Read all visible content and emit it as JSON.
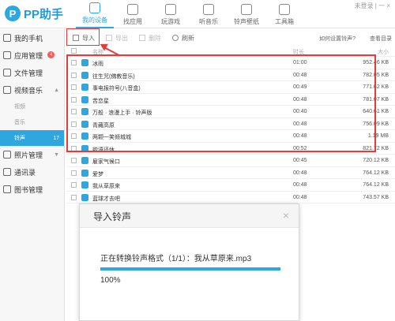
{
  "app": {
    "logo_text": "PP助手",
    "logo_mark": "P",
    "top_right": "未登录 | 一 ×"
  },
  "nav": [
    {
      "label": "我的设备",
      "icon": "phone-icon",
      "active": true
    },
    {
      "label": "找应用",
      "icon": "apps-icon",
      "active": false
    },
    {
      "label": "玩游戏",
      "icon": "game-icon",
      "active": false
    },
    {
      "label": "听音乐",
      "icon": "music-icon",
      "active": false
    },
    {
      "label": "铃声壁纸",
      "icon": "wallpaper-icon",
      "active": false
    },
    {
      "label": "工具箱",
      "icon": "toolbox-icon",
      "active": false
    }
  ],
  "sidebar": {
    "my_phone": "我的手机",
    "apps": "应用管理",
    "apps_badge": "4",
    "files": "文件管理",
    "video_music": "视频音乐",
    "sub_video": "视频",
    "sub_music": "音乐",
    "sub_ringtone": "铃声",
    "ringtone_count": "17",
    "photos": "照片管理",
    "contacts": "通讯录",
    "books": "图书管理"
  },
  "toolbar": {
    "import": "导入",
    "export": "导出",
    "delete": "删除",
    "refresh": "刷新",
    "help": "如何设置铃声?",
    "dir": "查看目录"
  },
  "table": {
    "headers": {
      "name": "名称",
      "duration": "时长",
      "size": "大小"
    },
    "rows": [
      {
        "name": "冰雨",
        "duration": "01:00",
        "size": "952.46 KB"
      },
      {
        "name": "往生咒(佛教音乐)",
        "duration": "00:48",
        "size": "782.05 KB"
      },
      {
        "name": "事电报符号(八音盒)",
        "duration": "00:49",
        "size": "771.62 KB"
      },
      {
        "name": "苦恋星",
        "duration": "00:48",
        "size": "781.07 KB"
      },
      {
        "name": "万般 · 浪漫上手 · 铃声版",
        "duration": "00:40",
        "size": "640.61 KB"
      },
      {
        "name": "青藏高原",
        "duration": "00:48",
        "size": "756.09 KB"
      },
      {
        "name": "两颗一笑倾城城",
        "duration": "00:48",
        "size": "1.19 MB"
      },
      {
        "name": "欲语还休",
        "duration": "00:52",
        "size": "821.72 KB"
      },
      {
        "name": "雇家气候口",
        "duration": "00:45",
        "size": "720.12 KB"
      },
      {
        "name": "爱梦",
        "duration": "00:48",
        "size": "764.12 KB"
      },
      {
        "name": "我从草原来",
        "duration": "00:48",
        "size": "764.12 KB"
      },
      {
        "name": "蓝球才去吧",
        "duration": "00:48",
        "size": "743.57 KB"
      }
    ]
  },
  "dialog": {
    "title": "导入铃声",
    "close": "×",
    "message": "正在转换铃声格式（1/1）：我从草原来.mp3",
    "progress_percent": 100,
    "percent_label": "100%"
  },
  "colors": {
    "accent": "#2ea7e0",
    "highlight_red": "#e33c3c"
  }
}
